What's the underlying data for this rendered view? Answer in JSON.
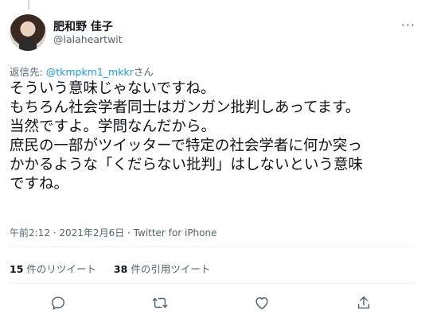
{
  "tweet": {
    "author_name": "肥和野 佳子",
    "author_handle": "@lalaheartwit",
    "reply_prefix": "返信先: ",
    "reply_mention": "@tkmpkm1_mkkr",
    "reply_suffix": "さん",
    "body_lines": [
      "そういう意味じゃないですね。",
      "もちろん社会学者同士はガンガン批判しあってます。",
      "当然ですよ。学問なんだから。",
      "庶民の一部がツイッターで特定の社会学者に何か突っ",
      "かかるような「くだらない批判」はしないという意味",
      "ですね。"
    ],
    "meta": "午前2:12 · 2021年2月6日 · Twitter for iPhone"
  },
  "stats": {
    "retweets_count": "15",
    "retweets_label": "件のリツイート",
    "quotes_count": "38",
    "quotes_label": "件の引用ツイート"
  },
  "icons": {
    "more": "more-dots-icon",
    "reply": "reply-icon",
    "retweet": "retweet-icon",
    "like": "like-icon",
    "share": "share-icon"
  },
  "colors": {
    "link": "#1d9bf0",
    "secondary_text": "#536471",
    "primary_text": "#0f1419",
    "divider": "#eff3f4"
  }
}
